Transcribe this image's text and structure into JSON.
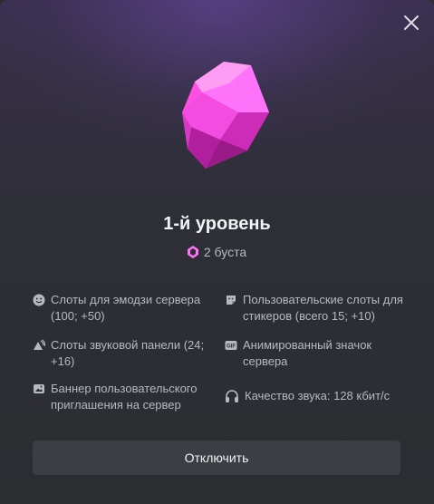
{
  "header": {
    "close_label": "close"
  },
  "tier": {
    "title": "1-й уровень",
    "boost_count": "2 буста"
  },
  "perks": [
    {
      "icon": "emoji-icon",
      "label": "Слоты для эмодзи сервера (100; +50)"
    },
    {
      "icon": "sticker-icon",
      "label": "Пользовательские слоты для стикеров (всего 15; +10)"
    },
    {
      "icon": "soundboard-icon",
      "label": "Слоты звуковой панели (24; +16)"
    },
    {
      "icon": "gif-icon",
      "label": "Анимированный значок сервера"
    },
    {
      "icon": "banner-icon",
      "label": "Баннер пользовательского приглашения на сервер"
    },
    {
      "icon": "headphones-icon",
      "label": "Качество звука: 128 кбит/с"
    }
  ],
  "actions": {
    "disable_label": "Отключить"
  },
  "colors": {
    "accent_pink": "#ff73fa",
    "button_bg": "#3c3e45"
  }
}
